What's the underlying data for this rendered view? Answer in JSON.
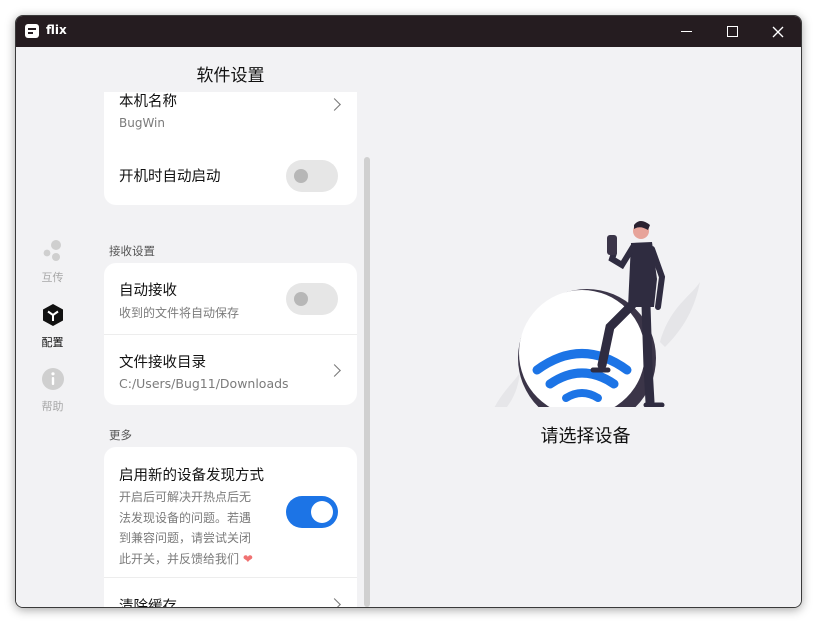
{
  "window": {
    "title": "flix"
  },
  "nav": {
    "items": [
      {
        "label": "互传",
        "icon": "share-dots-icon",
        "active": false
      },
      {
        "label": "配置",
        "icon": "cube-settings-icon",
        "active": true
      },
      {
        "label": "帮助",
        "icon": "info-icon",
        "active": false
      }
    ]
  },
  "settings": {
    "title": "软件设置",
    "device_name_title": "本机名称",
    "device_name_value": "BugWin",
    "autostart_title": "开机时自动启动",
    "autostart_on": false,
    "receive_section": "接收设置",
    "auto_receive_title": "自动接收",
    "auto_receive_desc": "收到的文件将自动保存",
    "auto_receive_on": false,
    "receive_dir_title": "文件接收目录",
    "receive_dir_value": "C:/Users/Bug11/Downloads",
    "more_section": "更多",
    "new_discovery_title": "启用新的设备发现方式",
    "new_discovery_desc": [
      "开启后可解决开热点后无",
      "法发现设备的问题。若遇",
      "到兼容问题，请尝试关闭",
      "此开关，并反馈给我们"
    ],
    "new_discovery_on": true,
    "clear_cache_title": "清除缓存"
  },
  "main": {
    "prompt": "请选择设备"
  },
  "colors": {
    "titlebar": "#251c20",
    "accent": "#1c74e6",
    "background": "#f2f2f4"
  }
}
